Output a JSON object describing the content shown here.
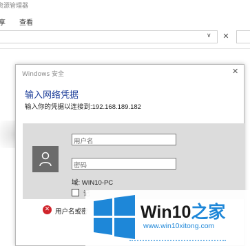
{
  "explorer": {
    "title": "资源管理器",
    "menu": [
      "享",
      "查看"
    ],
    "address_chevron": "∨",
    "close_glyph": "✕"
  },
  "dialog": {
    "title": "Windows 安全",
    "close_glyph": "✕",
    "heading": "输入网络凭据",
    "subtitle": "输入你的凭据以连接到:192.168.189.182",
    "username_placeholder": "用户名",
    "password_placeholder": "密码",
    "domain": "域: WIN10-PC",
    "remember_label": "记",
    "error_text": "用户名或密"
  },
  "watermark": {
    "brand_prefix": "Win10",
    "brand_suffix": "之家",
    "url": "www.win10xitong.com",
    "colors": {
      "accent": "#1e87d8"
    }
  }
}
